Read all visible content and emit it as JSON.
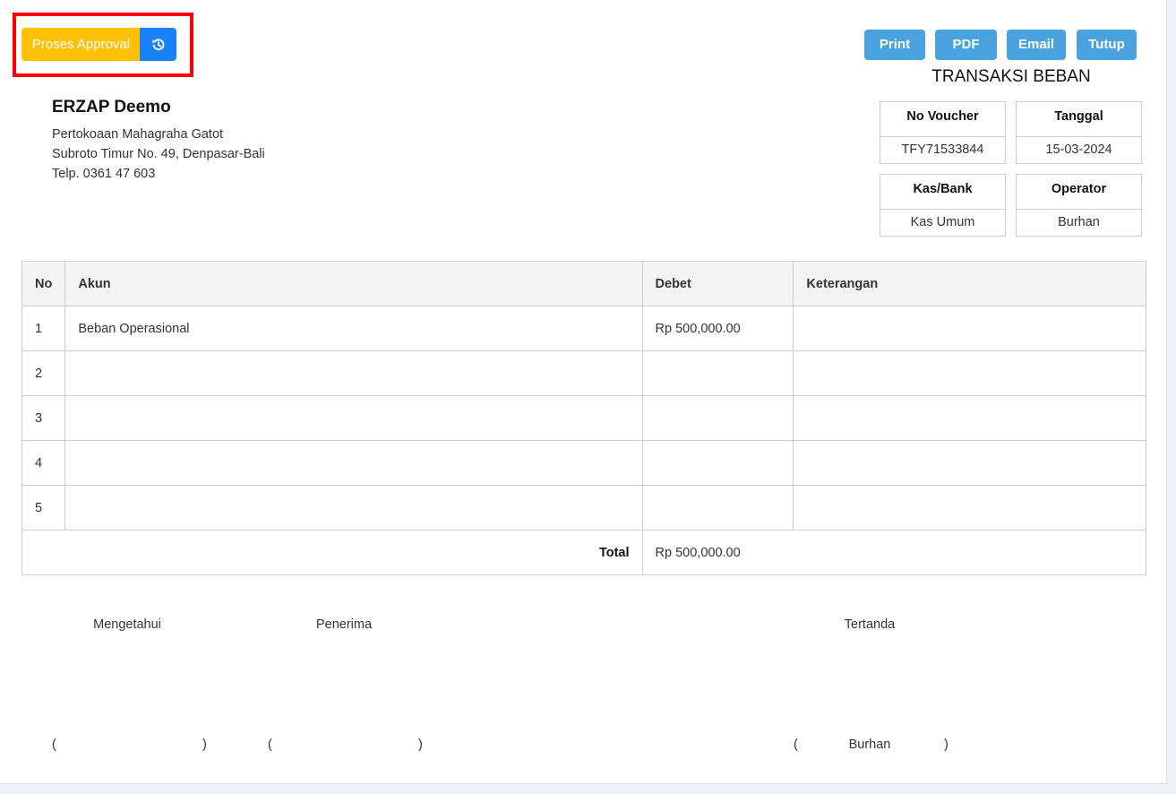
{
  "toolbar": {
    "approval_label": "Proses Approval",
    "history_icon": "history-icon",
    "print_label": "Print",
    "pdf_label": "PDF",
    "email_label": "Email",
    "close_label": "Tutup"
  },
  "colors": {
    "approval": "#ffc107",
    "history": "#1a82f7",
    "action_buttons": "#4aa3de",
    "highlight": "#ff0000"
  },
  "document": {
    "title": "TRANSAKSI BEBAN"
  },
  "company": {
    "name": "ERZAP Deemo",
    "address_line1": "Pertokoaan Mahagraha Gatot",
    "address_line2": "Subroto Timur No. 49, Denpasar-Bali",
    "phone": "Telp. 0361 47 603"
  },
  "info": {
    "voucher_label": "No Voucher",
    "voucher_value": "TFY71533844",
    "date_label": "Tanggal",
    "date_value": "15-03-2024",
    "cash_label": "Kas/Bank",
    "cash_value": "Kas Umum",
    "operator_label": "Operator",
    "operator_value": "Burhan"
  },
  "table": {
    "headers": [
      "No",
      "Akun",
      "Debet",
      "Keterangan"
    ],
    "rows": [
      {
        "no": "1",
        "akun": "Beban Operasional",
        "debet": "Rp 500,000.00",
        "keterangan": ""
      },
      {
        "no": "2",
        "akun": "",
        "debet": "",
        "keterangan": ""
      },
      {
        "no": "3",
        "akun": "",
        "debet": "",
        "keterangan": ""
      },
      {
        "no": "4",
        "akun": "",
        "debet": "",
        "keterangan": ""
      },
      {
        "no": "5",
        "akun": "",
        "debet": "",
        "keterangan": ""
      }
    ],
    "total_label": "Total",
    "total_value": "Rp 500,000.00"
  },
  "signatures": {
    "acknowledged_label": "Mengetahui",
    "receiver_label": "Penerima",
    "signed_label": "Tertanda",
    "signed_name": "Burhan",
    "paren_open": "(",
    "paren_close": ")"
  }
}
